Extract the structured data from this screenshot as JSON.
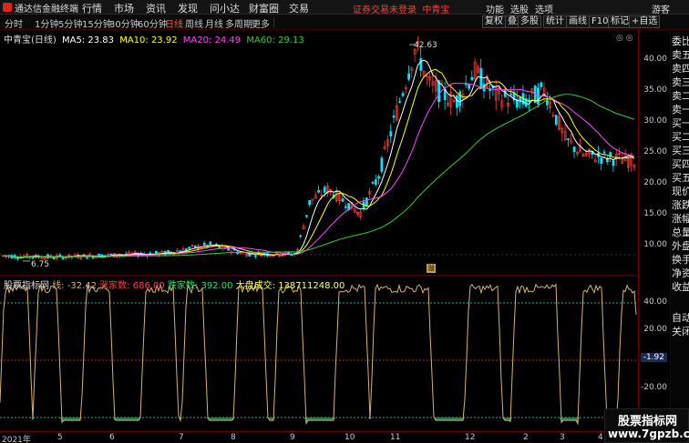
{
  "app": {
    "name": "通达信金融终端",
    "menus": [
      "行情",
      "市场",
      "资讯",
      "发现",
      "问小达",
      "财富圈",
      "交易"
    ],
    "notice": "证券交易未登录",
    "stock_short": "中青宝",
    "tools": [
      "功能",
      "选股",
      "选项",
      "游客"
    ]
  },
  "periods": [
    "分时",
    "1分钟",
    "5分钟",
    "15分钟",
    "30分钟",
    "60分钟",
    "日线",
    "周线",
    "月线",
    "多周期",
    "更多"
  ],
  "active_period": "日线",
  "toolbar_buttons": [
    "复权",
    "叠加",
    "多股",
    "统计",
    "画线",
    "F10",
    "标记",
    "+自选"
  ],
  "main_chart": {
    "title": "中青宝(日线)",
    "ma": [
      {
        "label": "MA5: 23.83",
        "color": "#ffffff"
      },
      {
        "label": "MA10: 23.92",
        "color": "#ffff00"
      },
      {
        "label": "MA20: 24.49",
        "color": "#ff44ff"
      },
      {
        "label": "MA60: 29.13",
        "color": "#33cc33"
      }
    ],
    "high_label": "42.63",
    "low_label": "6.75",
    "yticks": [
      "40.00",
      "35.00",
      "30.00",
      "25.00",
      "20.00",
      "15.00",
      "10.00"
    ]
  },
  "sub_chart": {
    "title": "股票指标网",
    "line_label": "线: -32.42",
    "up_label": "涨家数: 686.00",
    "down_label": "跌家数: 392.00",
    "vol_label": "大盘成交: 138711248.00",
    "yticks": [
      "40.00",
      "20.00",
      "-20.00"
    ],
    "cursor_value": "-1.92"
  },
  "xaxis": [
    "2021年",
    "5",
    "6",
    "7",
    "8",
    "9",
    "10",
    "11",
    "12",
    "2",
    "3",
    "4"
  ],
  "side_items": [
    "委比",
    "卖五",
    "卖四",
    "卖三",
    "卖二",
    "卖一",
    "买一",
    "买二",
    "买三",
    "买四",
    "买五",
    "现价",
    "涨跌",
    "涨幅",
    "总量",
    "外盘",
    "换手",
    "净资",
    "收益",
    "",
    "自动",
    "关闭"
  ],
  "watermark": {
    "line1": "股票指标网",
    "line2": "www.7gpzb.com"
  },
  "colors": {
    "up": "#ff3c3c",
    "down": "#00e4ff",
    "grid": "#7a0000",
    "osc": "#d8b070",
    "area": "#1f8f4e"
  }
}
